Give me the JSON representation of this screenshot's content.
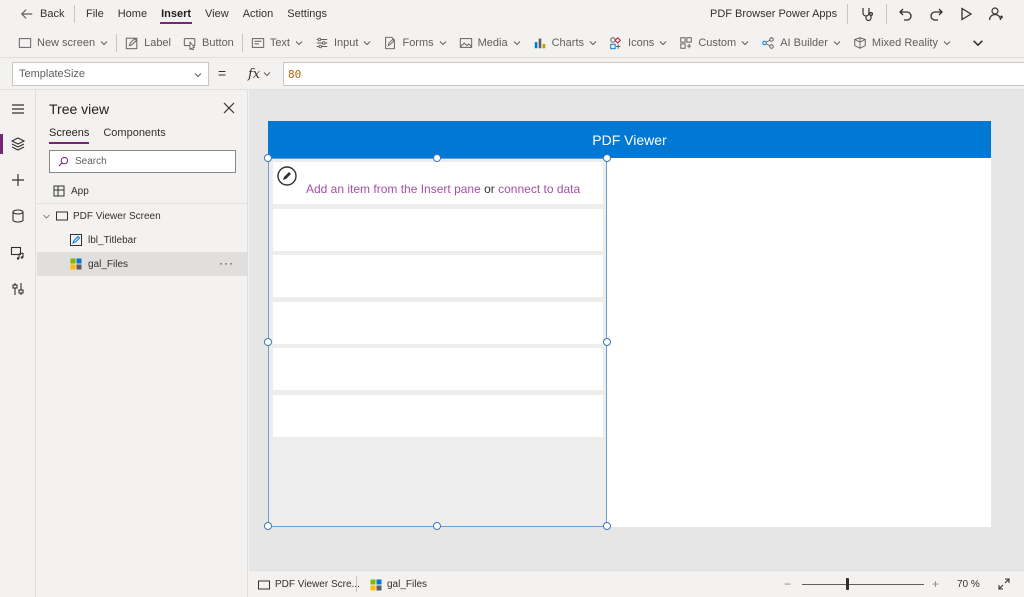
{
  "menubar": {
    "back_label": "Back",
    "items": [
      {
        "label": "File"
      },
      {
        "label": "Home"
      },
      {
        "label": "Insert",
        "active": true
      },
      {
        "label": "View"
      },
      {
        "label": "Action"
      },
      {
        "label": "Settings"
      }
    ],
    "app_name": "PDF Browser Power Apps"
  },
  "ribbon": {
    "new_screen": "New screen",
    "label": "Label",
    "button": "Button",
    "text": "Text",
    "input": "Input",
    "forms": "Forms",
    "media": "Media",
    "charts": "Charts",
    "icons": "Icons",
    "custom": "Custom",
    "ai_builder": "AI Builder",
    "mixed_reality": "Mixed Reality"
  },
  "formula": {
    "property": "TemplateSize",
    "equals": "=",
    "fx": "fx",
    "value": "80"
  },
  "tree": {
    "title": "Tree view",
    "tabs": [
      {
        "label": "Screens",
        "active": true
      },
      {
        "label": "Components"
      }
    ],
    "search_placeholder": "Search",
    "app_label": "App",
    "screen_label": "PDF Viewer Screen",
    "children": [
      {
        "label": "lbl_Titlebar"
      },
      {
        "label": "gal_Files",
        "selected": true
      }
    ],
    "more": "···"
  },
  "canvas": {
    "titlebar_text": "PDF Viewer",
    "hint_insert": "Add an item from the Insert pane",
    "hint_or": "or",
    "hint_connect": "connect to data"
  },
  "statusbar": {
    "screen_crumb": "PDF Viewer Scre...",
    "control_crumb": "gal_Files",
    "zoom_minus": "−",
    "zoom_plus": "+",
    "zoom_value": "70  %",
    "zoom_level_percent": 70
  },
  "colors": {
    "accent": "#742774",
    "titlebar": "#0078d4",
    "hint": "#a350a3",
    "formula_value": "#b0640b"
  }
}
